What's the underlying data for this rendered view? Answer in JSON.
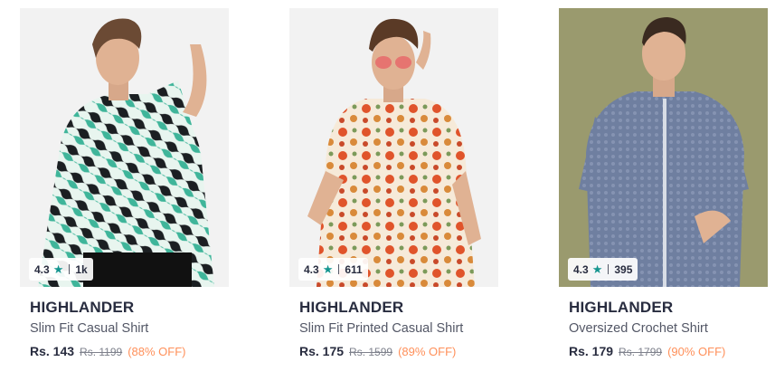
{
  "products": [
    {
      "image": "model-in-green-zebra-print-shirt",
      "background": "#f2f2f2",
      "rating": "4.3",
      "rating_count": "1k",
      "brand": "HIGHLANDER",
      "name": "Slim Fit Casual Shirt",
      "price": "Rs. 143",
      "mrp": "Rs. 1199",
      "discount": "(88% OFF)"
    },
    {
      "image": "model-in-floral-printed-shirt",
      "background": "#f2f2f2",
      "rating": "4.3",
      "rating_count": "611",
      "brand": "HIGHLANDER",
      "name": "Slim Fit Printed Casual Shirt",
      "price": "Rs. 175",
      "mrp": "Rs. 1599",
      "discount": "(89% OFF)"
    },
    {
      "image": "model-in-blue-crochet-shirt",
      "background": "#9a9a6e",
      "rating": "4.3",
      "rating_count": "395",
      "brand": "HIGHLANDER",
      "name": "Oversized Crochet Shirt",
      "price": "Rs. 179",
      "mrp": "Rs. 1799",
      "discount": "(90% OFF)"
    }
  ],
  "icons": {
    "rating": "star-icon"
  },
  "colors": {
    "rating_star": "#14958f",
    "discount": "#ff905a",
    "brand_text": "#282c3f"
  }
}
